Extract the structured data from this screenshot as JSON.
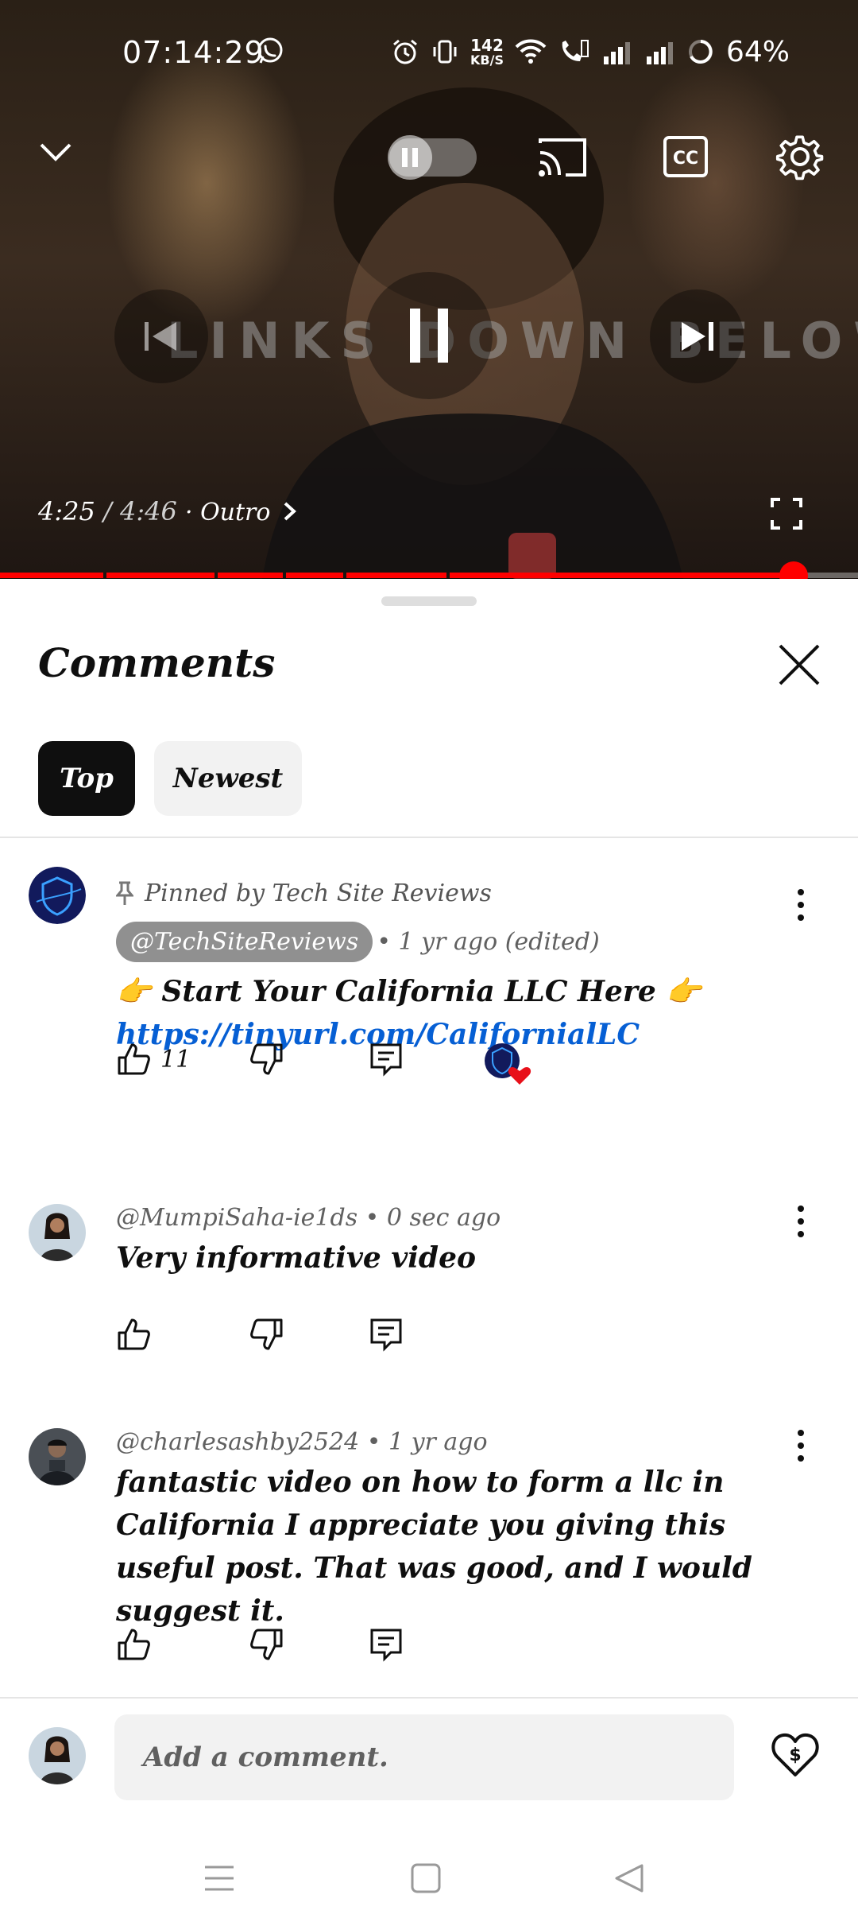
{
  "status_bar": {
    "time": "07:14:29",
    "net_speed_value": "142",
    "net_speed_unit": "KB/S",
    "battery": "64%"
  },
  "player": {
    "overlay_text": "LINKS DOWN BELOW",
    "time_current": "4:25",
    "time_separator": " / ",
    "time_total": "4:46",
    "chapter": "· Outro",
    "progress": 0.925,
    "chapter_marks": [
      0.12,
      0.25,
      0.33,
      0.4,
      0.52
    ]
  },
  "comments_panel": {
    "title": "Comments",
    "filters": [
      {
        "label": "Top",
        "active": true
      },
      {
        "label": "Newest",
        "active": false
      }
    ],
    "comments": [
      {
        "pinned_label": "Pinned by Tech Site Reviews",
        "author": "@TechSiteReviews",
        "meta": "• 1 yr ago (edited)",
        "text_line1": "👉 Start Your California LLC Here 👉",
        "link": "https://tinyurl.com/CalifornialLC",
        "likes": "11"
      },
      {
        "author_meta": "@MumpiSaha-ie1ds • 0 sec ago",
        "text": "Very informative video"
      },
      {
        "author_meta": "@charlesashby2524 • 1 yr ago",
        "text": "fantastic video on how to form a llc in California I appreciate you giving this useful post. That was good, and I would suggest it."
      }
    ],
    "add_comment_placeholder": "Add a comment."
  },
  "colors": {
    "accent_red": "#ff0000",
    "link_blue": "#065fd4",
    "heart": "#e8101a"
  }
}
